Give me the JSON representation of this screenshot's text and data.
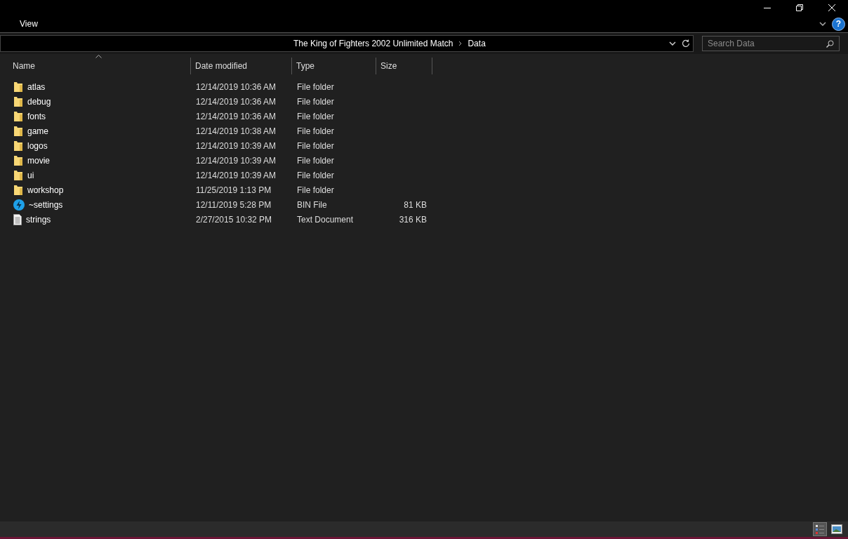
{
  "window": {
    "help": "?"
  },
  "ribbon": {
    "tabs": [
      {
        "label": "View"
      }
    ]
  },
  "address_bar": {
    "path": [
      "The King of Fighters 2002 Unlimited Match",
      "Data"
    ]
  },
  "search": {
    "placeholder": "Search Data"
  },
  "table": {
    "columns": [
      {
        "label": "Name",
        "sorted": true
      },
      {
        "label": "Date modified",
        "sorted": false
      },
      {
        "label": "Type",
        "sorted": false
      },
      {
        "label": "Size",
        "sorted": false
      }
    ],
    "rows": [
      {
        "kind": "folder",
        "name": "atlas",
        "date": "12/14/2019 10:36 AM",
        "type": "File folder",
        "size": ""
      },
      {
        "kind": "folder",
        "name": "debug",
        "date": "12/14/2019 10:36 AM",
        "type": "File folder",
        "size": ""
      },
      {
        "kind": "folder",
        "name": "fonts",
        "date": "12/14/2019 10:36 AM",
        "type": "File folder",
        "size": ""
      },
      {
        "kind": "folder",
        "name": "game",
        "date": "12/14/2019 10:38 AM",
        "type": "File folder",
        "size": ""
      },
      {
        "kind": "folder",
        "name": "logos",
        "date": "12/14/2019 10:39 AM",
        "type": "File folder",
        "size": ""
      },
      {
        "kind": "folder",
        "name": "movie",
        "date": "12/14/2019 10:39 AM",
        "type": "File folder",
        "size": ""
      },
      {
        "kind": "folder",
        "name": "ui",
        "date": "12/14/2019 10:39 AM",
        "type": "File folder",
        "size": ""
      },
      {
        "kind": "folder",
        "name": "workshop",
        "date": "11/25/2019 1:13 PM",
        "type": "File folder",
        "size": ""
      },
      {
        "kind": "bin",
        "name": "~settings",
        "date": "12/11/2019 5:28 PM",
        "type": "BIN File",
        "size": "81 KB"
      },
      {
        "kind": "text",
        "name": "strings",
        "date": "2/27/2015 10:32 PM",
        "type": "Text Document",
        "size": "316 KB"
      }
    ]
  },
  "status_bar": {
    "views": [
      {
        "kind": "details",
        "selected": true
      },
      {
        "kind": "tiles",
        "selected": false
      }
    ]
  }
}
